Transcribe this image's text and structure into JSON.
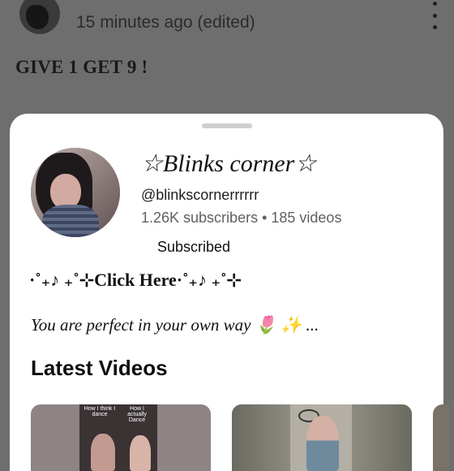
{
  "post": {
    "time_label": "15 minutes ago (edited)",
    "text": "GIVE 1 GET 9 !"
  },
  "channel": {
    "name": "☆Blinks corner☆",
    "handle": "@blinkscornerrrrrr",
    "stats": "1.26K subscribers • 185 videos",
    "subscribe_state": "Subscribed",
    "link_text": "·˚₊♪ ₊˚⊹Click Here·˚₊♪ ₊˚⊹",
    "tagline": "You are perfect in your own way 🌷 ✨ ..."
  },
  "sections": {
    "latest_videos": "Latest Videos"
  },
  "thumbnails": [
    {
      "caption_left": "How I think I dance",
      "caption_right": "How I actually Dance"
    },
    {},
    {}
  ],
  "colors": {
    "scrim": "#6e6e6e",
    "sheet": "#ffffff",
    "secondary_text": "#606060"
  }
}
